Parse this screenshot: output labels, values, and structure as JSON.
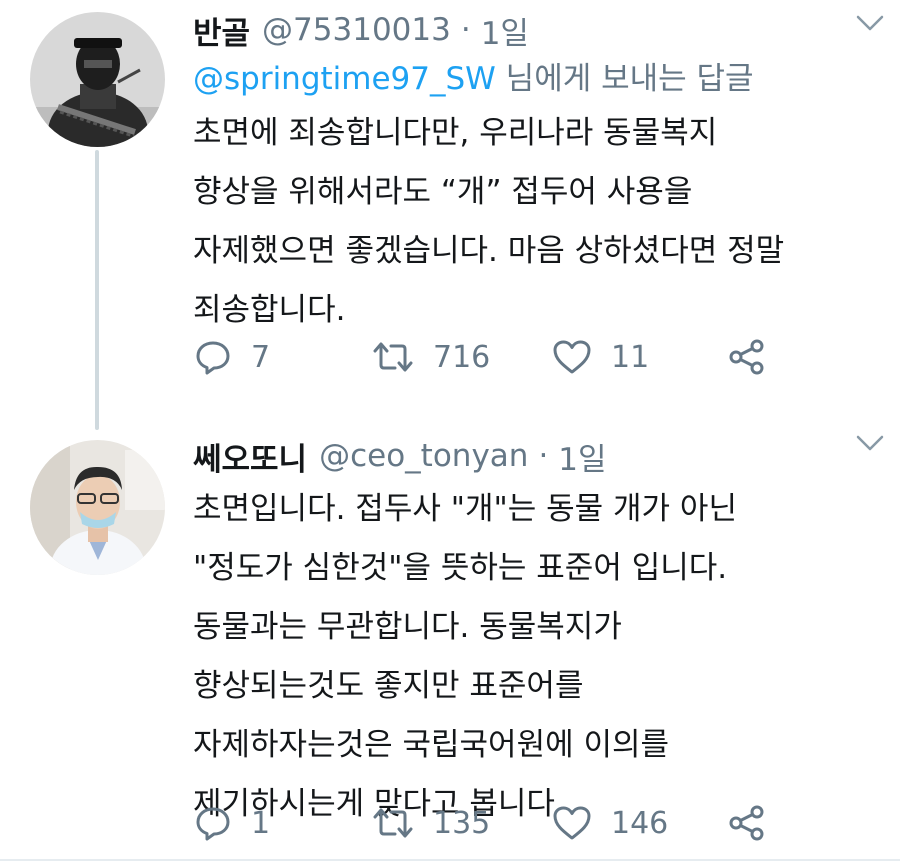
{
  "tweets": [
    {
      "name": "반골",
      "handle": "@75310013",
      "dot": "·",
      "time": "1일",
      "reply_to": {
        "mention": "@springtime97_SW",
        "suffix": " 님에게 보내는 답글"
      },
      "lines": [
        "초면에 죄송합니다만, 우리나라 동물복지",
        "향상을 위해서라도 “개” 접두어 사용을",
        "자제했으면 좋겠습니다. 마음 상하셨다면 정말",
        "죄송합니다."
      ],
      "stats": {
        "replies": "7",
        "retweets": "716",
        "likes": "11"
      }
    },
    {
      "name": "쎄오또니",
      "handle": "@ceo_tonyan",
      "dot": "·",
      "time": "1일",
      "lines": [
        "초면입니다. 접두사 \"개\"는 동물 개가 아닌",
        "\"정도가 심한것\"을 뜻하는 표준어 입니다.",
        "동물과는 무관합니다. 동물복지가",
        "향상되는것도 좋지만 표준어를",
        "자제하자는것은 국립국어원에 이의를",
        "제기하시는게 맞다고 봅니다"
      ],
      "stats": {
        "replies": "1",
        "retweets": "135",
        "likes": "146"
      }
    }
  ],
  "colors": {
    "text": "#14171a",
    "secondary": "#657786",
    "link": "#1da1f2",
    "thread_line": "#cfd9de"
  },
  "icons": {
    "chevron": "chevron-down-icon",
    "reply": "reply-icon",
    "retweet": "retweet-icon",
    "like": "heart-icon",
    "share": "share-icon"
  }
}
